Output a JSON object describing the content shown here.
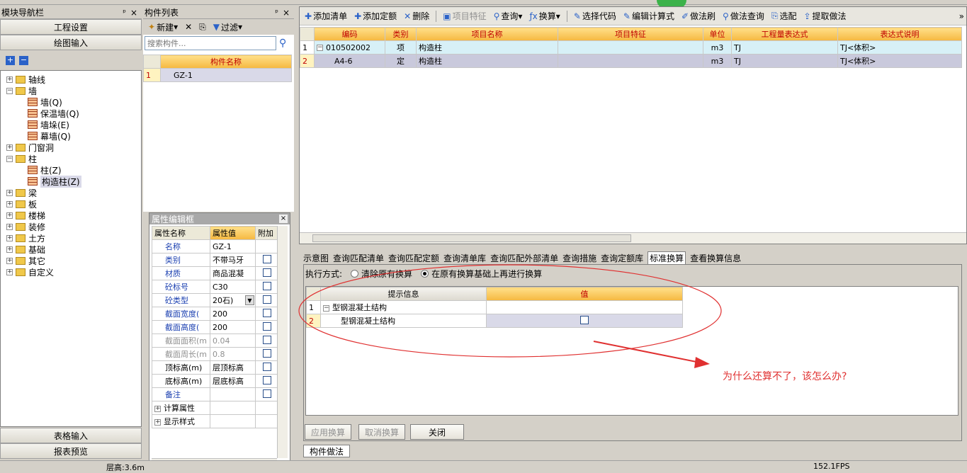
{
  "nav": {
    "title": "模块导航栏",
    "btn1": "工程设置",
    "btn2": "绘图输入",
    "btn3": "表格输入",
    "btn4": "报表预览",
    "tree": [
      {
        "label": "轴线",
        "level": 0,
        "exp": "+"
      },
      {
        "label": "墙",
        "level": 0,
        "exp": "-"
      },
      {
        "label": "墙(Q)",
        "level": 1,
        "exp": ""
      },
      {
        "label": "保温墙(Q)",
        "level": 1,
        "exp": ""
      },
      {
        "label": "墙垛(E)",
        "level": 1,
        "exp": ""
      },
      {
        "label": "幕墙(Q)",
        "level": 1,
        "exp": ""
      },
      {
        "label": "门窗洞",
        "level": 0,
        "exp": "+"
      },
      {
        "label": "柱",
        "level": 0,
        "exp": "-"
      },
      {
        "label": "柱(Z)",
        "level": 1,
        "exp": ""
      },
      {
        "label": "构造柱(Z)",
        "level": 1,
        "exp": "",
        "selected": true
      },
      {
        "label": "梁",
        "level": 0,
        "exp": "+"
      },
      {
        "label": "板",
        "level": 0,
        "exp": "+"
      },
      {
        "label": "楼梯",
        "level": 0,
        "exp": "+"
      },
      {
        "label": "装修",
        "level": 0,
        "exp": "+"
      },
      {
        "label": "土方",
        "level": 0,
        "exp": "+"
      },
      {
        "label": "基础",
        "level": 0,
        "exp": "+"
      },
      {
        "label": "其它",
        "level": 0,
        "exp": "+"
      },
      {
        "label": "自定义",
        "level": 0,
        "exp": "+"
      }
    ]
  },
  "comp": {
    "title": "构件列表",
    "new_label": "新建",
    "filter_label": "过滤",
    "search_placeholder": "搜索构件...",
    "col_header": "构件名称",
    "rows": [
      {
        "num": "1",
        "name": "GZ-1"
      }
    ]
  },
  "prop": {
    "title": "属性编辑框",
    "headers": [
      "属性名称",
      "属性值",
      "附加"
    ],
    "rows": [
      {
        "name": "名称",
        "value": "GZ-1",
        "blue": true,
        "chk": false
      },
      {
        "name": "类别",
        "value": "不带马牙",
        "blue": true,
        "chk": true
      },
      {
        "name": "材质",
        "value": "商品混凝",
        "blue": true,
        "chk": true
      },
      {
        "name": "砼标号",
        "value": "C30",
        "blue": true,
        "chk": true
      },
      {
        "name": "砼类型",
        "value": "20石)",
        "blue": true,
        "chk": true,
        "dropdown": true
      },
      {
        "name": "截面宽度(",
        "value": "200",
        "blue": true,
        "chk": true
      },
      {
        "name": "截面高度(",
        "value": "200",
        "blue": true,
        "chk": true
      },
      {
        "name": "截面面积(m",
        "value": "0.04",
        "gray": true,
        "chk": true
      },
      {
        "name": "截面周长(m",
        "value": "0.8",
        "gray": true,
        "chk": true
      },
      {
        "name": "顶标高(m)",
        "value": "层顶标高",
        "chk": true
      },
      {
        "name": "底标高(m)",
        "value": "层底标高",
        "chk": true
      },
      {
        "name": "备注",
        "value": "",
        "blue": true,
        "chk": true
      },
      {
        "name": "计算属性",
        "value": "",
        "plus": true
      },
      {
        "name": "显示样式",
        "value": "",
        "plus": true
      }
    ]
  },
  "toolbar": [
    "添加清单",
    "添加定额",
    "删除",
    "项目特征",
    "查询",
    "换算",
    "选择代码",
    "编辑计算式",
    "做法刷",
    "做法查询",
    "选配",
    "提取做法"
  ],
  "main": {
    "headers": [
      "编码",
      "类别",
      "项目名称",
      "项目特征",
      "单位",
      "工程量表达式",
      "表达式说明"
    ],
    "rows": [
      {
        "num": "1",
        "code": "010502002",
        "type": "项",
        "name": "构造柱",
        "feature": "",
        "unit": "m3",
        "expr": "TJ",
        "desc": "TJ<体积>"
      },
      {
        "num": "2",
        "code": "A4-6",
        "type": "定",
        "name": "构造柱",
        "feature": "",
        "unit": "m3",
        "expr": "TJ",
        "desc": "TJ<体积>"
      }
    ]
  },
  "tabs": [
    "示意图",
    "查询匹配清单",
    "查询匹配定额",
    "查询清单库",
    "查询匹配外部清单",
    "查询措施",
    "查询定额库",
    "标准换算",
    "查看换算信息"
  ],
  "conv": {
    "exec_label": "执行方式:",
    "opt1": "清除原有换算",
    "opt2": "在原有换算基础上再进行换算",
    "headers": [
      "提示信息",
      "值"
    ],
    "rows": [
      {
        "num": "1",
        "label": "型钢混凝土结构"
      },
      {
        "num": "2",
        "label": "型钢混凝土结构"
      }
    ],
    "apply": "应用换算",
    "cancel": "取消换算",
    "close": "关闭"
  },
  "annotation": "为什么还算不了，该怎么办?",
  "bottom_tab": "构件做法",
  "status": {
    "height": "层高:3.6m",
    "fps": "152.1FPS"
  }
}
